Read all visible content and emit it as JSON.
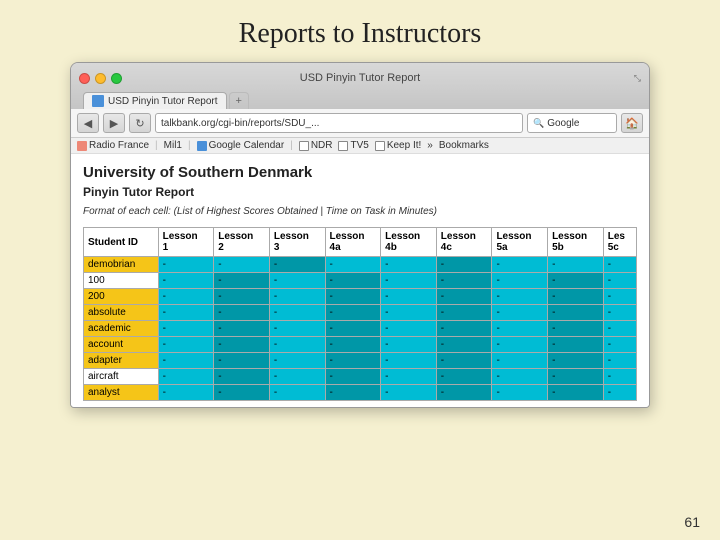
{
  "page": {
    "title": "Reports to Instructors",
    "page_number": "61"
  },
  "browser": {
    "window_title": "USD Pinyin Tutor Report",
    "tab_label": "USD Pinyin Tutor Report",
    "tab_new_label": "+",
    "address": "talkbank.org/cgi-bin/reports/SDU_...",
    "search_placeholder": "Google",
    "nav_back": "◀",
    "nav_forward": "▶",
    "nav_reload": "↻",
    "resize_icon": "⤡",
    "bookmarks": [
      {
        "label": "Radio France",
        "type": "radio"
      },
      {
        "label": "Mil1",
        "type": "mil"
      },
      {
        "label": "Google Calendar",
        "type": "google"
      },
      {
        "label": "NDR",
        "type": "ndr"
      },
      {
        "label": "TV5",
        "type": "tv"
      },
      {
        "label": "Keep It!",
        "type": "keep"
      },
      {
        "label": "»",
        "type": "more"
      },
      {
        "label": "Bookmarks",
        "type": "bookmarks"
      }
    ]
  },
  "report": {
    "university": "University of Southern Denmark",
    "report_title": "Pinyin Tutor Report",
    "format_note": "Format of each cell: (List of Highest Scores Obtained | Time on Task in Minutes)",
    "table": {
      "columns": [
        "Student ID",
        "Lesson 1",
        "Lesson 2",
        "Lesson 3",
        "Lesson 4a",
        "Lesson 4b",
        "Lesson 4c",
        "Lesson 5a",
        "Lesson 5b",
        "Les 5c"
      ],
      "rows": [
        {
          "id": "demobrian",
          "type": "yellow",
          "cells": [
            "-",
            "-",
            "-",
            "-",
            "-",
            "-",
            "-",
            "-",
            "-"
          ]
        },
        {
          "id": "100",
          "type": "white",
          "cells": [
            "-",
            "-",
            "-",
            "-",
            "-",
            "-",
            "-",
            "-",
            "-"
          ]
        },
        {
          "id": "200",
          "type": "yellow",
          "cells": [
            "-",
            "-",
            "-",
            "-",
            "-",
            "-",
            "-",
            "-",
            "-"
          ]
        },
        {
          "id": "absolute",
          "type": "yellow",
          "cells": [
            "-",
            "-",
            "-",
            "-",
            "-",
            "-",
            "-",
            "-",
            "-"
          ]
        },
        {
          "id": "academic",
          "type": "yellow",
          "cells": [
            "-",
            "-",
            "-",
            "-",
            "-",
            "-",
            "-",
            "-",
            "-"
          ]
        },
        {
          "id": "account",
          "type": "yellow",
          "cells": [
            "-",
            "-",
            "-",
            "-",
            "-",
            "-",
            "-",
            "-",
            "-"
          ]
        },
        {
          "id": "adapter",
          "type": "yellow",
          "cells": [
            "-",
            "-",
            "-",
            "-",
            "-",
            "-",
            "-",
            "-",
            "-"
          ]
        },
        {
          "id": "aircraft",
          "type": "white",
          "cells": [
            "-",
            "-",
            "-",
            "-",
            "-",
            "-",
            "-",
            "-",
            "-"
          ]
        },
        {
          "id": "analyst",
          "type": "yellow",
          "cells": [
            "-",
            "-",
            "-",
            "-",
            "-",
            "-",
            "-",
            "-",
            "-"
          ]
        }
      ]
    }
  }
}
